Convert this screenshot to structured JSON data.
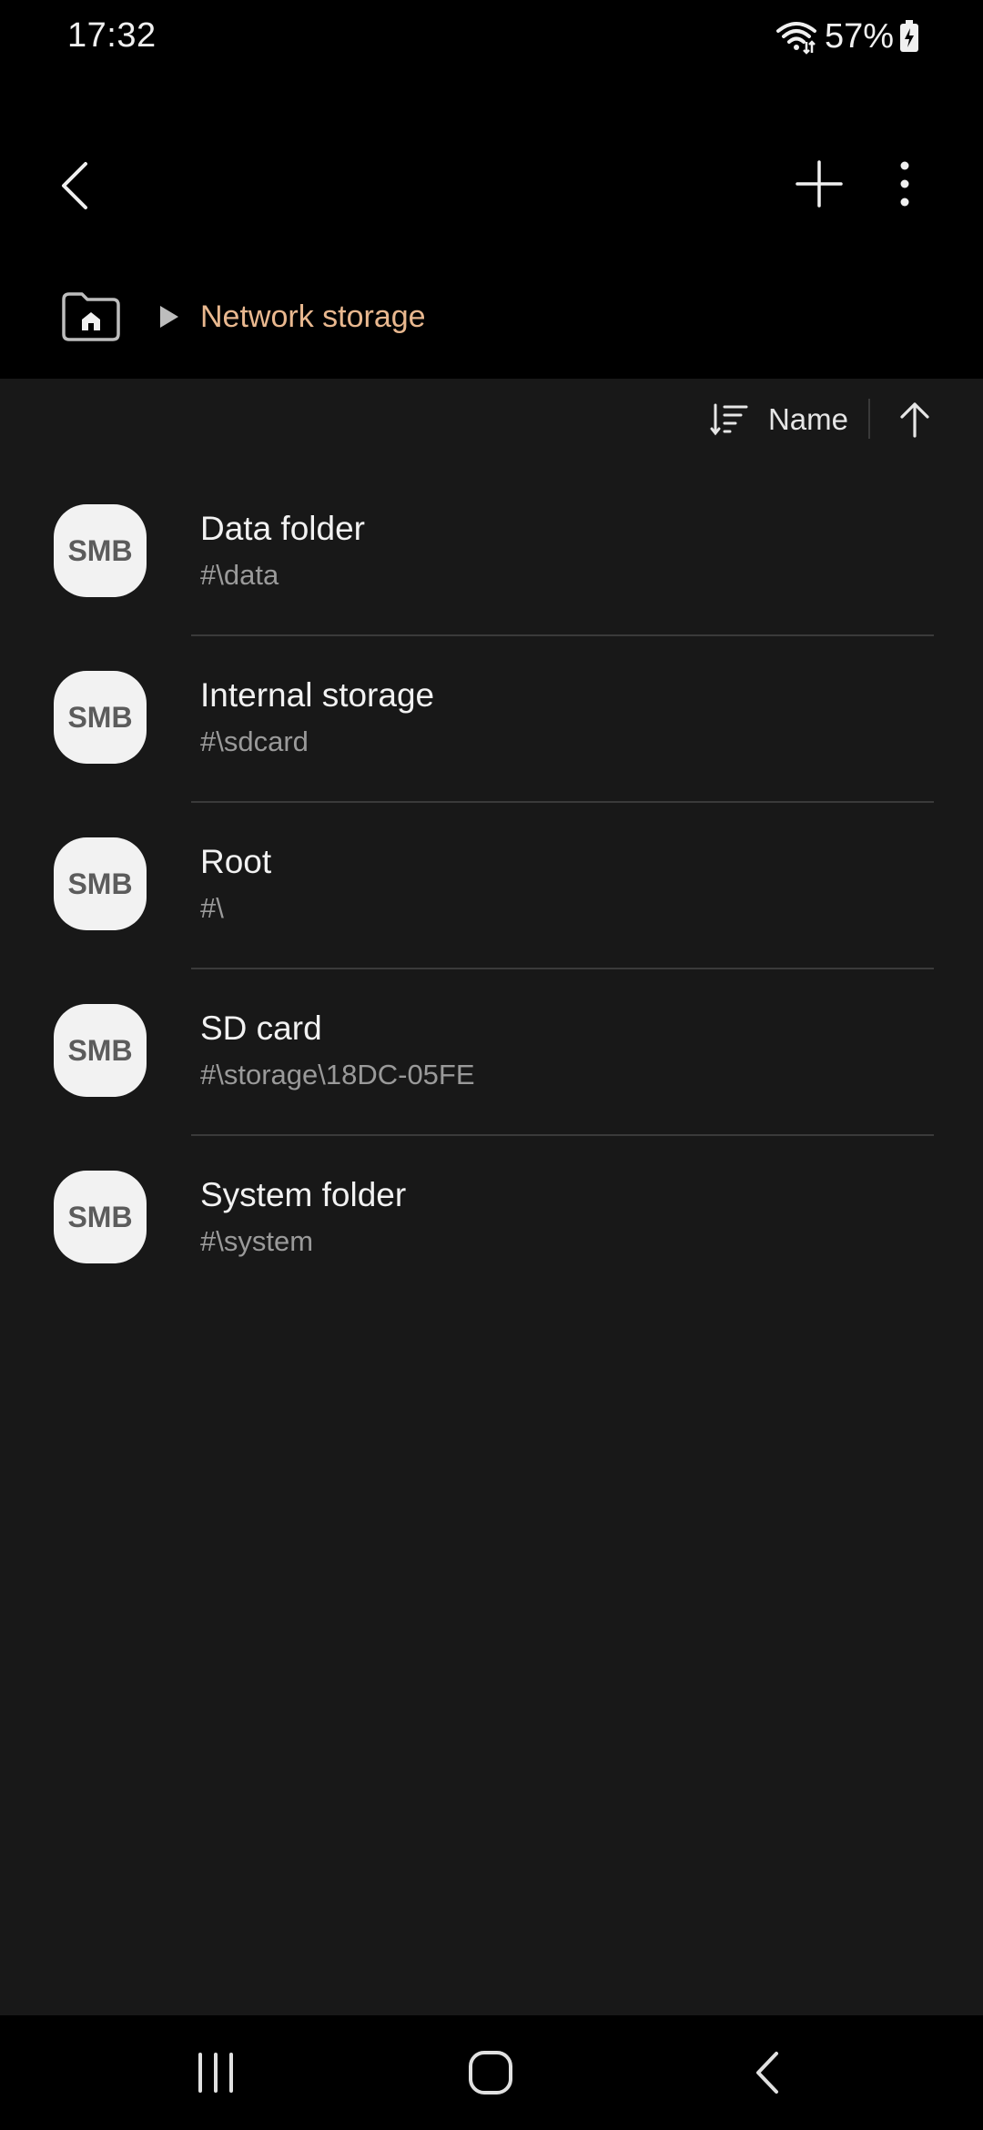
{
  "status_bar": {
    "time": "17:32",
    "battery": "57%",
    "icons": [
      "wifi-icon",
      "battery-charging-icon"
    ]
  },
  "app_bar": {
    "icons": [
      "back-arrow-icon",
      "plus-icon",
      "more-vert-icon"
    ]
  },
  "breadcrumb": {
    "home_icon": "home-folder-icon",
    "separator_icon": "triangle-right-icon",
    "current": "Network storage"
  },
  "sort": {
    "label": "Name",
    "icons": [
      "sort-icon",
      "arrow-up-icon"
    ]
  },
  "items": [
    {
      "badge": "SMB",
      "title": "Data folder",
      "path": "#\\data"
    },
    {
      "badge": "SMB",
      "title": "Internal storage",
      "path": "#\\sdcard"
    },
    {
      "badge": "SMB",
      "title": "Root",
      "path": "#\\"
    },
    {
      "badge": "SMB",
      "title": "SD card",
      "path": "#\\storage\\18DC-05FE"
    },
    {
      "badge": "SMB",
      "title": "System folder",
      "path": "#\\system"
    }
  ],
  "nav_bar": {
    "icons": [
      "recents-icon",
      "home-icon",
      "back-icon"
    ]
  },
  "colors": {
    "background": "#000000",
    "content_background": "#181818",
    "breadcrumb_accent": "#e9b88f",
    "secondary_text": "#9a9a9a",
    "badge_background": "#f2f2f2"
  }
}
